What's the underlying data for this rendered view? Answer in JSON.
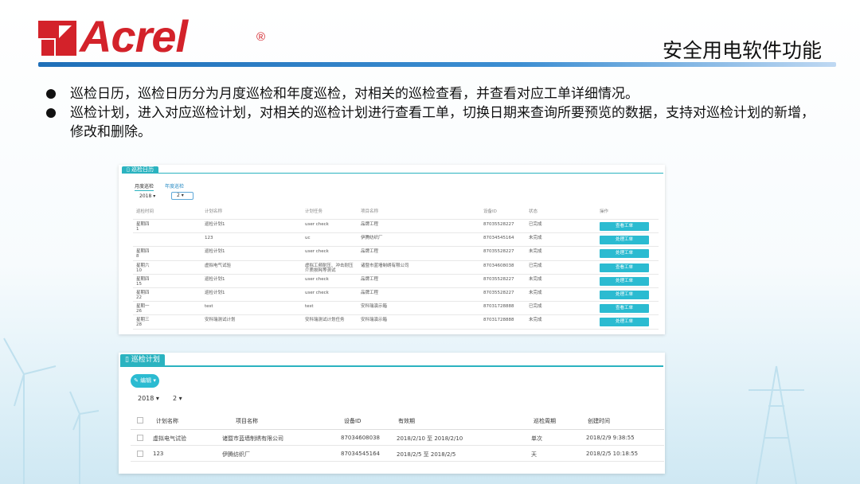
{
  "brand": {
    "name": "Acrel",
    "registered": "®",
    "color": "#d3222a"
  },
  "page_title": "安全用电软件功能",
  "bullets": [
    "巡检日历，巡检日历分为月度巡检和年度巡检，对相关的巡检查看，并查看对应工单详细情况。",
    "巡检计划，进入对应巡检计划，对相关的巡检计划进行查看工单，切换日期来查询所要预览的数据，支持对巡检计划的新增，修改和删除。"
  ],
  "calendar_panel": {
    "title": "巡检日历",
    "tabs": [
      "月度巡检",
      "年度巡检"
    ],
    "year": "2018",
    "month": "2",
    "columns": [
      "巡检时间",
      "计划名称",
      "计划任务",
      "项目名称",
      "设备ID",
      "状态",
      "操作"
    ],
    "rows": [
      {
        "date": "星期四",
        "day": "1",
        "plan": "巡检计划1",
        "task": "user check",
        "project": "品牌工程",
        "device": "87035528227",
        "status": "已完成",
        "action": "查看工单"
      },
      {
        "date": "",
        "day": "",
        "plan": "123",
        "task": "uc",
        "project": "伊腾纺织厂",
        "device": "87034545164",
        "status": "未完成",
        "action": "处理工单"
      },
      {
        "date": "星期四",
        "day": "8",
        "plan": "巡检计划1",
        "task": "user check",
        "project": "品牌工程",
        "device": "87035528227",
        "status": "未完成",
        "action": "处理工单"
      },
      {
        "date": "星期六",
        "day": "10",
        "plan": "虚拟电气试验",
        "task": "虚拟工频耐压、冲击耐压 介质损耗等测试",
        "project": "诸暨市蓝墙制绣有限公司",
        "device": "87034608038",
        "status": "已完成",
        "action": "查看工单"
      },
      {
        "date": "星期四",
        "day": "15",
        "plan": "巡检计划1",
        "task": "user check",
        "project": "品牌工程",
        "device": "87035528227",
        "status": "未完成",
        "action": "处理工单"
      },
      {
        "date": "星期四",
        "day": "22",
        "plan": "巡检计划1",
        "task": "user check",
        "project": "品牌工程",
        "device": "87035528227",
        "status": "未完成",
        "action": "处理工单"
      },
      {
        "date": "星期一",
        "day": "26",
        "plan": "test",
        "task": "test",
        "project": "安科瑞演示箱",
        "device": "87031728888",
        "status": "已完成",
        "action": "查看工单"
      },
      {
        "date": "星期三",
        "day": "28",
        "plan": "安科瑞测试计划",
        "task": "安科瑞测试计划任务",
        "project": "安科瑞演示箱",
        "device": "87031728888",
        "status": "未完成",
        "action": "处理工单"
      }
    ]
  },
  "plan_panel": {
    "title": "巡检计划",
    "edit_label": "编辑",
    "edit_icon": "pencil-icon",
    "year": "2018",
    "month": "2",
    "columns": [
      "计划名称",
      "项目名称",
      "设备ID",
      "有效期",
      "巡检周期",
      "创建时间"
    ],
    "rows": [
      {
        "name": "虚拟电气试验",
        "project": "诸暨市蓝墙制绣有限公司",
        "device": "87034608038",
        "validity": "2018/2/10 至 2018/2/10",
        "cycle": "单次",
        "created": "2018/2/9 9:38:55"
      },
      {
        "name": "123",
        "project": "伊腾纺织厂",
        "device": "87034545164",
        "validity": "2018/2/5 至 2018/2/5",
        "cycle": "天",
        "created": "2018/2/5 10:18:55"
      }
    ]
  },
  "colors": {
    "accent": "#2bb3c0",
    "button": "#2bbbd1",
    "header_line": "#1f6fb8"
  }
}
